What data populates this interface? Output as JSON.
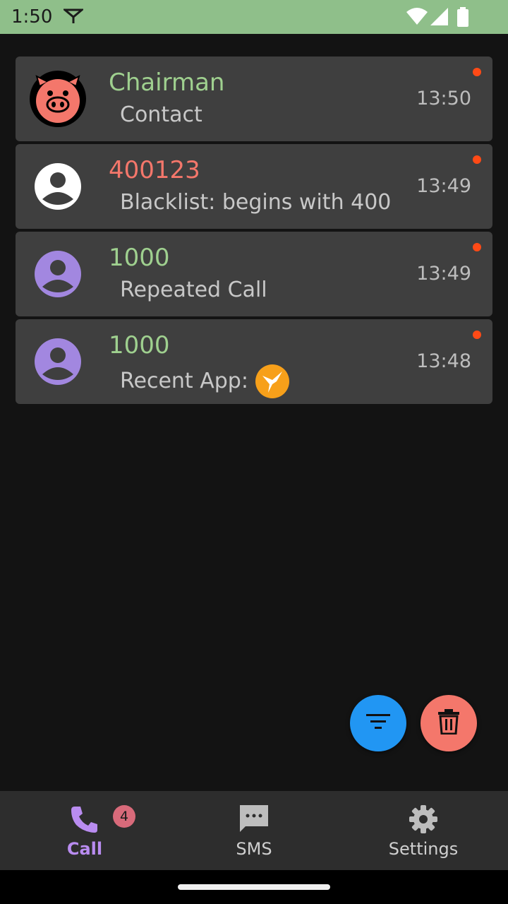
{
  "status_bar": {
    "time": "1:50",
    "background": "#8fbf8a"
  },
  "calls": [
    {
      "title": "Chairman",
      "title_color": "#9fd08f",
      "subtitle": "Contact",
      "time": "13:50",
      "avatar": "pig-avatar-icon",
      "unread": true
    },
    {
      "title": "400123",
      "title_color": "#f4776b",
      "subtitle": "Blacklist: begins with 400",
      "time": "13:49",
      "avatar": "person-avatar-white-icon",
      "unread": true
    },
    {
      "title": "1000",
      "title_color": "#9fd08f",
      "subtitle": "Repeated Call",
      "time": "13:49",
      "avatar": "person-avatar-purple-icon",
      "unread": true
    },
    {
      "title": "1000",
      "title_color": "#9fd08f",
      "subtitle": "Recent App:",
      "time": "13:48",
      "avatar": "person-avatar-purple-icon",
      "app_icon": "hummingbird-app-icon",
      "unread": true
    }
  ],
  "fabs": {
    "filter_icon": "filter-icon",
    "delete_icon": "trash-icon",
    "filter_color": "#2196f3",
    "delete_color": "#f4776b"
  },
  "bottom_nav": {
    "items": [
      {
        "label": "Call",
        "icon": "phone-icon",
        "active": true,
        "badge": "4"
      },
      {
        "label": "SMS",
        "icon": "sms-icon",
        "active": false
      },
      {
        "label": "Settings",
        "icon": "gear-icon",
        "active": false
      }
    ],
    "active_color": "#b98cf0"
  }
}
